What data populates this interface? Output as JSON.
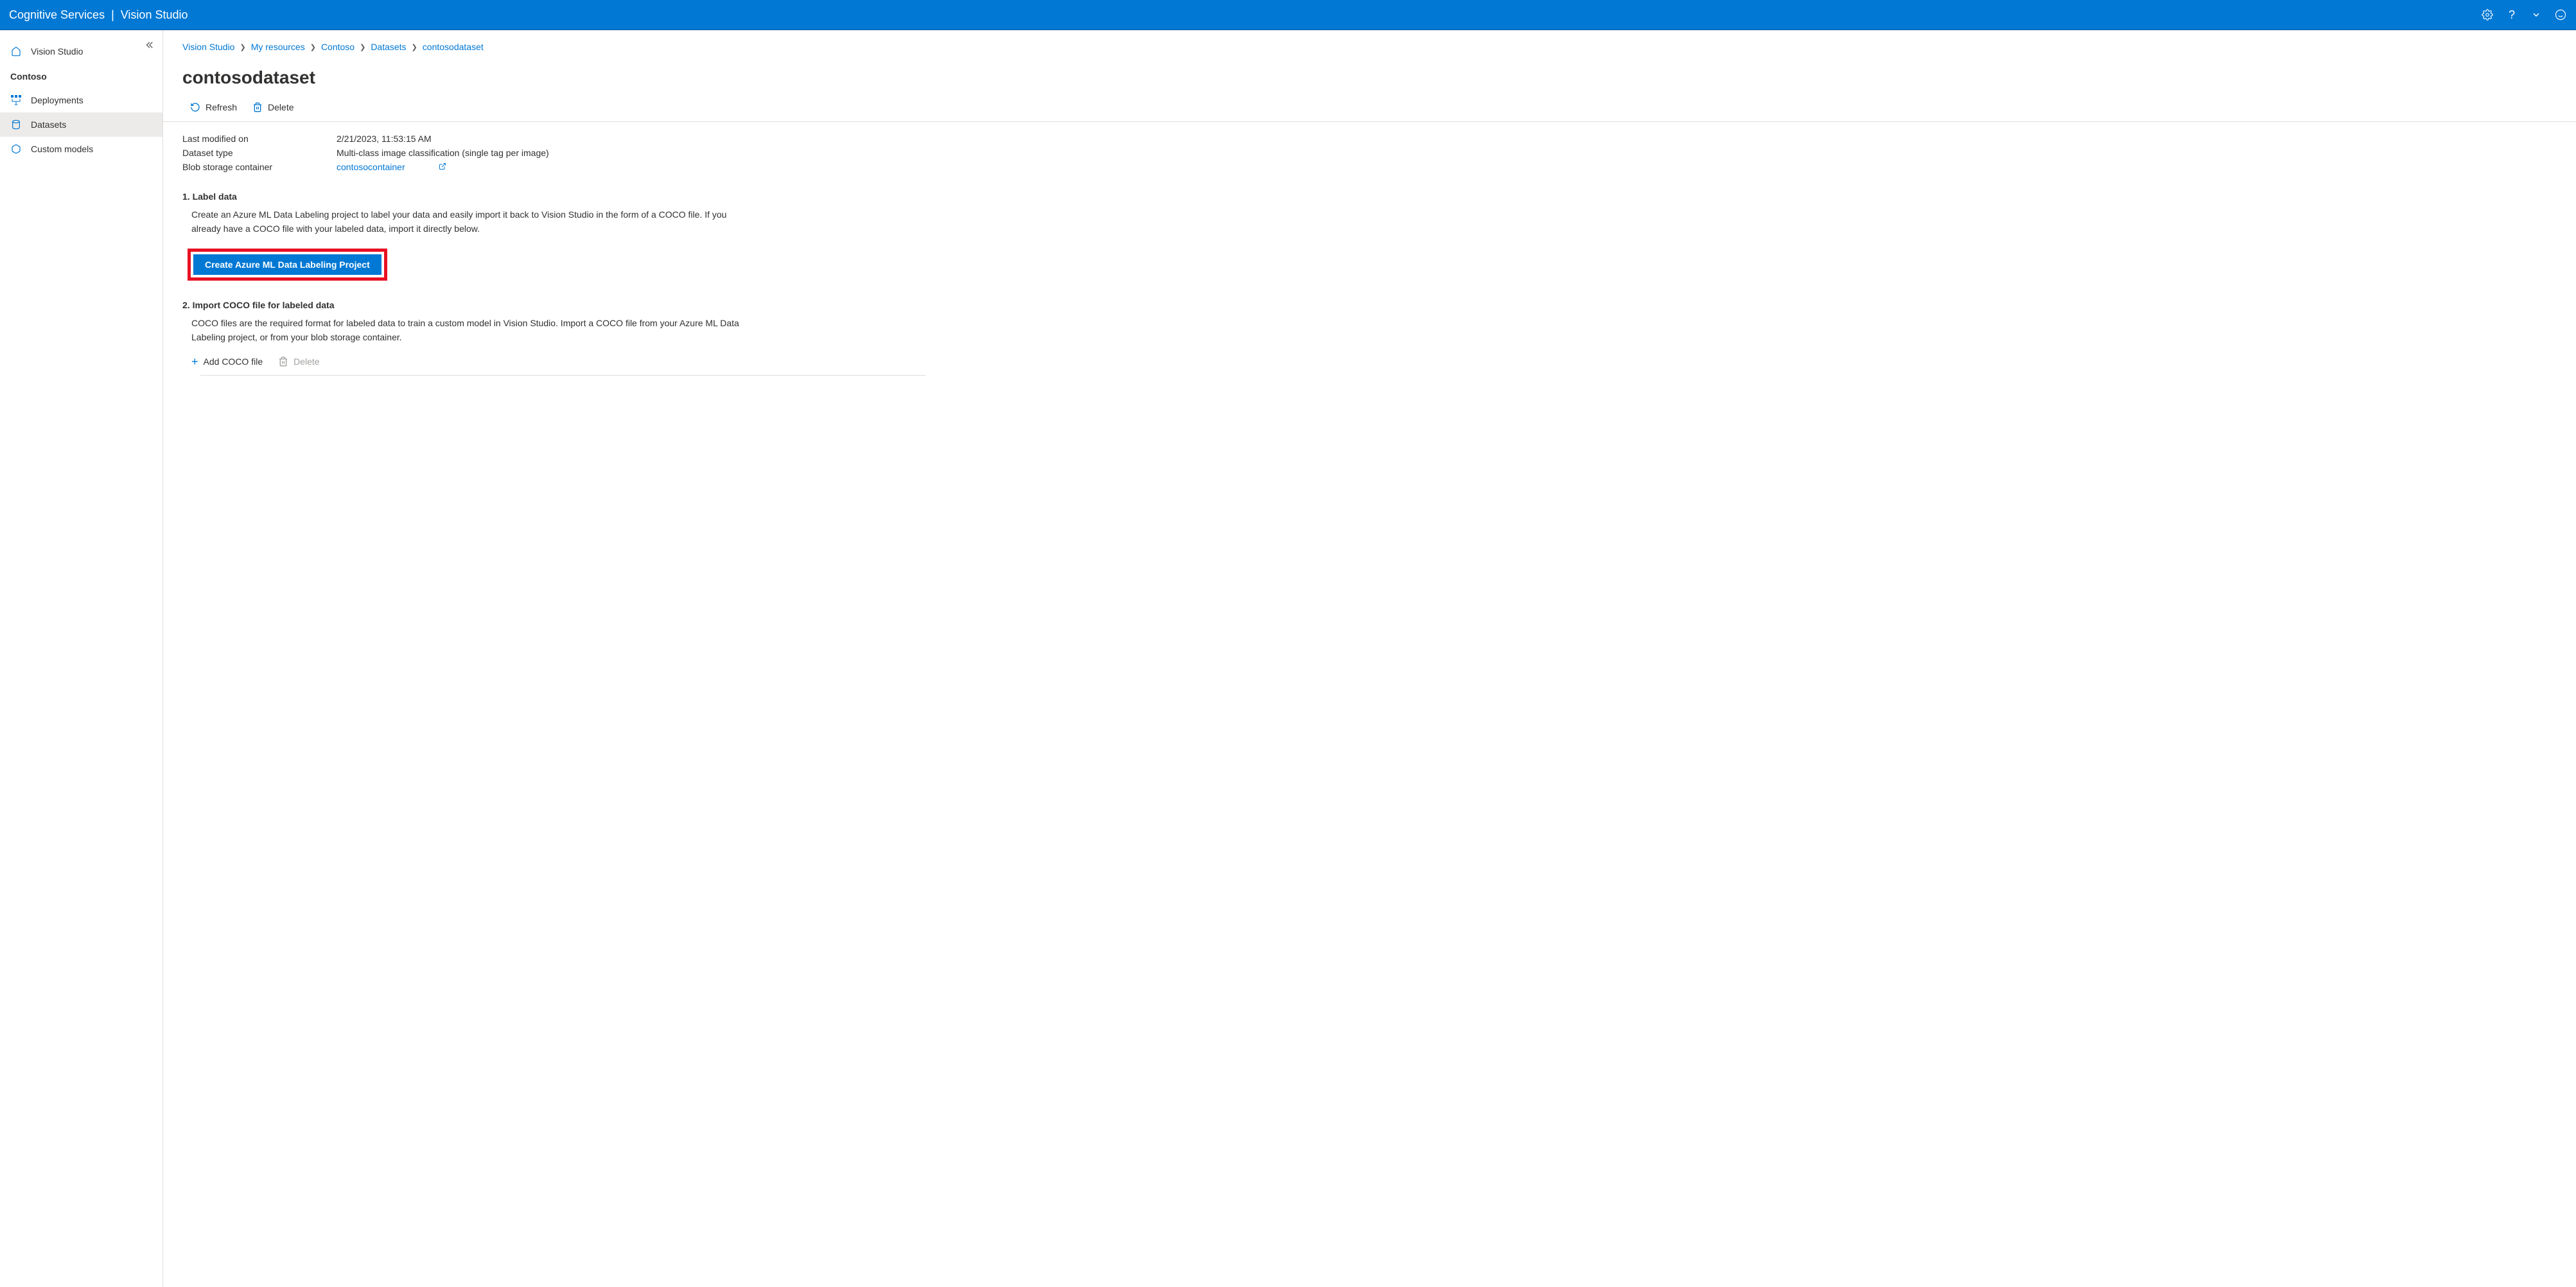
{
  "header": {
    "app_name": "Cognitive Services",
    "subtitle": "Vision Studio"
  },
  "sidebar": {
    "home_label": "Vision Studio",
    "section_label": "Contoso",
    "items": [
      {
        "label": "Deployments"
      },
      {
        "label": "Datasets"
      },
      {
        "label": "Custom models"
      }
    ]
  },
  "breadcrumb": {
    "items": [
      "Vision Studio",
      "My resources",
      "Contoso",
      "Datasets",
      "contosodataset"
    ]
  },
  "page": {
    "title": "contosodataset",
    "refresh_label": "Refresh",
    "delete_label": "Delete"
  },
  "details": {
    "last_modified_label": "Last modified on",
    "last_modified_value": "2/21/2023, 11:53:15 AM",
    "dataset_type_label": "Dataset type",
    "dataset_type_value": "Multi-class image classification (single tag per image)",
    "blob_label": "Blob storage container",
    "blob_value": "contosocontainer"
  },
  "section1": {
    "title": "1. Label data",
    "desc": "Create an Azure ML Data Labeling project to label your data and easily import it back to Vision Studio in the form of a COCO file. If you already have a COCO file with your labeled data, import it directly below.",
    "button": "Create Azure ML Data Labeling Project"
  },
  "section2": {
    "title": "2. Import COCO file for labeled data",
    "desc": "COCO files are the required format for labeled data to train a custom model in Vision Studio. Import a COCO file from your Azure ML Data Labeling project, or from your blob storage container.",
    "add_label": "Add COCO file",
    "delete_label": "Delete"
  }
}
